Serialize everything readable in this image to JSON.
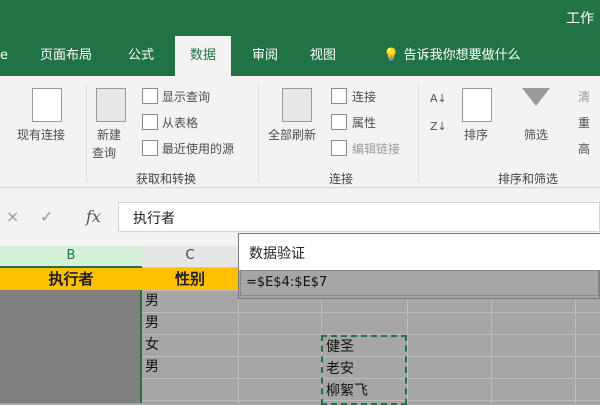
{
  "window": {
    "title": "工作"
  },
  "tabs": [
    "页面布局",
    "公式",
    "数据",
    "审阅",
    "视图"
  ],
  "tell_me": "告诉我你想要做什么",
  "ribbon": {
    "existing_connections": "现有连接",
    "new_query": {
      "line1": "新建",
      "line2": "查询"
    },
    "show_queries": "显示查询",
    "from_table": "从表格",
    "recent_sources": "最近使用的源",
    "get_transform_label": "获取和转换",
    "refresh_all": "全部刷新",
    "connections": "连接",
    "properties": "属性",
    "edit_links": "编辑链接",
    "connections_label": "连接",
    "sort": "排序",
    "filter": "筛选",
    "clear_partial": "清",
    "reapply_partial": "重",
    "advanced_partial": "高",
    "sort_filter_label": "排序和筛选"
  },
  "formula_bar": {
    "content": "执行者",
    "fx": "fx",
    "cancel": "×",
    "confirm": "✓"
  },
  "grid": {
    "col_b": "B",
    "col_c": "C",
    "header_b": "执行者",
    "header_c": "性别",
    "col_c_values": [
      "男",
      "男",
      "女",
      "男"
    ],
    "e_values": [
      "健圣",
      "老安",
      "柳絮飞"
    ]
  },
  "dialog": {
    "title": "数据验证",
    "source": "=$E$4:$E$7"
  },
  "colors": {
    "accent": "#217346",
    "header_fill": "#ffc000"
  }
}
